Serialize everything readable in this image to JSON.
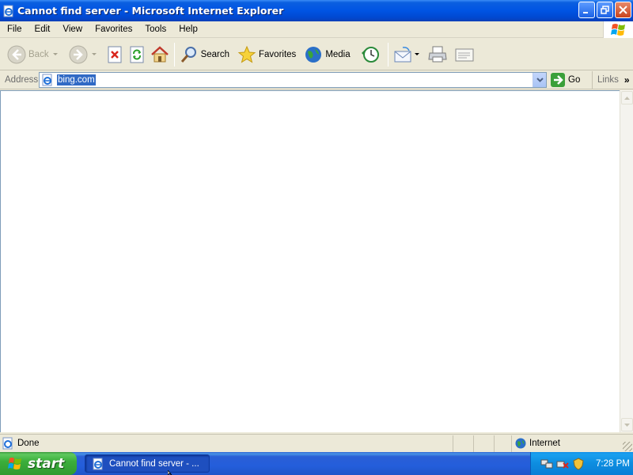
{
  "window": {
    "title": "Cannot find server - Microsoft Internet Explorer"
  },
  "menu": [
    "File",
    "Edit",
    "View",
    "Favorites",
    "Tools",
    "Help"
  ],
  "toolbar": {
    "back_label": "Back",
    "search_label": "Search",
    "favorites_label": "Favorites",
    "media_label": "Media"
  },
  "address": {
    "label": "Address",
    "value": "bing.com",
    "go_label": "Go",
    "links_label": "Links"
  },
  "status": {
    "text": "Done",
    "zone": "Internet"
  },
  "taskbar": {
    "start_label": "start",
    "task_label": "Cannot find server - ...",
    "clock": "7:28 PM"
  },
  "colors": {
    "titlebar": "#0054e3",
    "selection": "#316ac5",
    "start_green": "#3bae3b",
    "taskbar_blue": "#245edb"
  }
}
